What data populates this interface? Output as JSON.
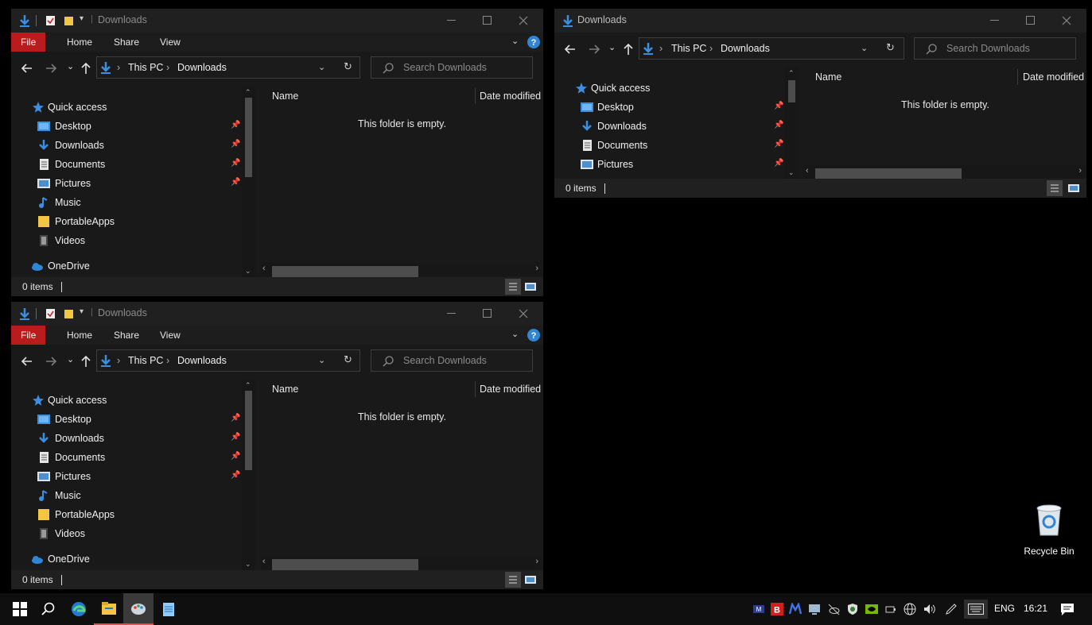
{
  "windows": [
    {
      "title": "Downloads",
      "ribbon_tabs": [
        "File",
        "Home",
        "Share",
        "View"
      ],
      "address": {
        "this_pc": "This PC",
        "current": "Downloads"
      },
      "search_placeholder": "Search Downloads",
      "nav": {
        "quick_access": "Quick access",
        "items": [
          "Desktop",
          "Downloads",
          "Documents",
          "Pictures",
          "Music",
          "PortableApps",
          "Videos"
        ],
        "onedrive": "OneDrive"
      },
      "columns": {
        "name": "Name",
        "date": "Date modified"
      },
      "empty_message": "This folder is empty.",
      "status": "0 items"
    },
    {
      "title": "Downloads",
      "ribbon_tabs": [
        "File",
        "Home",
        "Share",
        "View"
      ],
      "address": {
        "this_pc": "This PC",
        "current": "Downloads"
      },
      "search_placeholder": "Search Downloads",
      "nav": {
        "quick_access": "Quick access",
        "items": [
          "Desktop",
          "Downloads",
          "Documents",
          "Pictures",
          "Music",
          "PortableApps",
          "Videos"
        ],
        "onedrive": "OneDrive"
      },
      "columns": {
        "name": "Name",
        "date": "Date modified"
      },
      "empty_message": "This folder is empty.",
      "status": "0 items"
    },
    {
      "title": "Downloads",
      "address": {
        "this_pc": "This PC",
        "current": "Downloads"
      },
      "search_placeholder": "Search Downloads",
      "nav": {
        "quick_access": "Quick access",
        "items": [
          "Desktop",
          "Downloads",
          "Documents",
          "Pictures"
        ]
      },
      "columns": {
        "name": "Name",
        "date": "Date modified"
      },
      "empty_message": "This folder is empty.",
      "status": "0 items"
    }
  ],
  "desktop": {
    "recycle_bin": "Recycle Bin"
  },
  "taskbar": {
    "apps": [
      "start-icon",
      "search-icon",
      "edge-icon",
      "file-explorer-icon",
      "paint-icon",
      "notepad-icon"
    ],
    "language": "ENG",
    "time": "16:21"
  },
  "colors": {
    "accent_file_tab": "#b91c1c",
    "help_blue": "#2f86d6",
    "folder_blue": "#3b8ee0"
  }
}
